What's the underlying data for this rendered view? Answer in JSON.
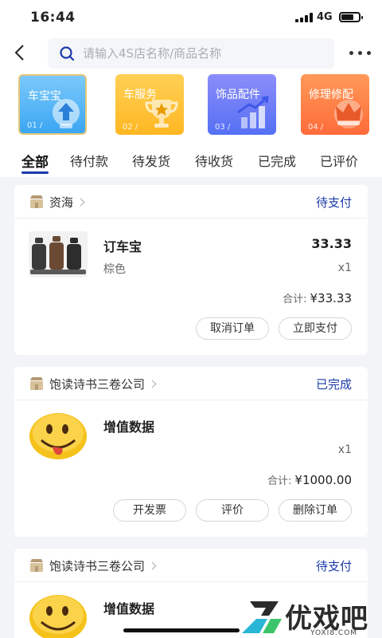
{
  "status_bar": {
    "time": "16:44",
    "network": "4G"
  },
  "search": {
    "placeholder": "请输入4S店名称/商品名称"
  },
  "categories": [
    {
      "label": "车宝宝",
      "num": "01 /",
      "icon": "upload-arrow-icon"
    },
    {
      "label": "车服务",
      "num": "02 /",
      "icon": "trophy-icon"
    },
    {
      "label": "饰品配件",
      "num": "03 /",
      "icon": "bar-chart-icon"
    },
    {
      "label": "修理修配",
      "num": "04 /",
      "icon": "crown-icon"
    }
  ],
  "tabs": [
    {
      "label": "全部",
      "active": true
    },
    {
      "label": "待付款"
    },
    {
      "label": "待发货"
    },
    {
      "label": "待收货"
    },
    {
      "label": "已完成"
    },
    {
      "label": "已评价"
    }
  ],
  "orders": [
    {
      "shop": "资海",
      "status": "待支付",
      "product": {
        "name": "订车宝",
        "spec": "棕色",
        "price": "33.33",
        "qty": "x1",
        "image": "car-seat-covers"
      },
      "total_label": "合计:",
      "total": "¥33.33",
      "buttons": [
        "取消订单",
        "立即支付"
      ]
    },
    {
      "shop": "饱读诗书三卷公司",
      "status": "已完成",
      "product": {
        "name": "增值数据",
        "qty": "x1",
        "image": "emoji-face"
      },
      "total_label": "合计:",
      "total": "¥1000.00",
      "buttons": [
        "开发票",
        "评价",
        "删除订单"
      ]
    },
    {
      "shop": "饱读诗书三卷公司",
      "status": "待支付",
      "product": {
        "name": "增值数据",
        "image": "emoji-face"
      }
    }
  ],
  "watermark": {
    "text": "优戏吧",
    "sub": "YOXI8.COM"
  },
  "colors": {
    "accent": "#1a3aa8",
    "background": "#f3f4f8"
  }
}
